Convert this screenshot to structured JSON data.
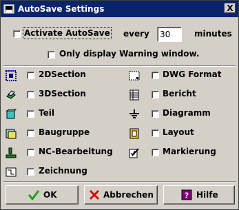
{
  "window": {
    "title": "AutoSave Settings",
    "close_glyph": "X"
  },
  "autosave": {
    "activate_label": "Activate AutoSave",
    "every_label": "every",
    "interval_value": "30",
    "unit_label": "minutes",
    "warning_only_label": "Only display Warning window."
  },
  "categories": {
    "left": [
      {
        "label": "2DSection",
        "icon": "2d-section-icon"
      },
      {
        "label": "3DSection",
        "icon": "3d-section-icon"
      },
      {
        "label": "Teil",
        "icon": "part-icon"
      },
      {
        "label": "Baugruppe",
        "icon": "assembly-icon"
      },
      {
        "label": "NC-Bearbeitung",
        "icon": "nc-machining-icon"
      },
      {
        "label": "Zeichnung",
        "icon": "drawing-icon"
      }
    ],
    "right": [
      {
        "label": "DWG Format",
        "icon": "dwg-format-icon"
      },
      {
        "label": "Bericht",
        "icon": "report-icon"
      },
      {
        "label": "Diagramm",
        "icon": "diagram-icon"
      },
      {
        "label": "Layout",
        "icon": "layout-icon"
      },
      {
        "label": "Markierung",
        "icon": "markup-icon"
      }
    ]
  },
  "buttons": {
    "ok": "OK",
    "cancel": "Abbrechen",
    "help": "Hilfe"
  },
  "colors": {
    "titlebar": "#0a246a",
    "dialog_bg": "#d4d0c8",
    "ok_check": "#1aa31a",
    "cancel_x": "#d01010",
    "help_icon": "#800080"
  }
}
